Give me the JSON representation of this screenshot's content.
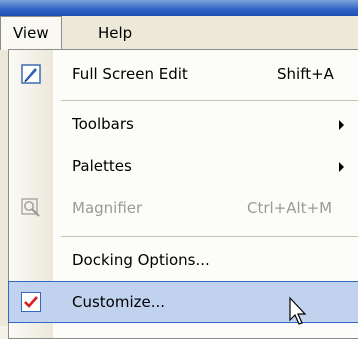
{
  "menubar": {
    "items": [
      {
        "label": "View",
        "active": true
      },
      {
        "label": "Help",
        "active": false
      }
    ]
  },
  "menu": {
    "items": [
      {
        "label": "Full Screen Edit",
        "shortcut": "Shift+A",
        "icon": "full-screen-edit-icon",
        "disabled": false,
        "submenu": false
      },
      {
        "label": "Toolbars",
        "shortcut": "",
        "icon": "",
        "disabled": false,
        "submenu": true
      },
      {
        "label": "Palettes",
        "shortcut": "",
        "icon": "",
        "disabled": false,
        "submenu": true
      },
      {
        "label": "Magnifier",
        "shortcut": "Ctrl+Alt+M",
        "icon": "magnifier-icon",
        "disabled": true,
        "submenu": false
      },
      {
        "label": "Docking Options...",
        "shortcut": "",
        "icon": "",
        "disabled": false,
        "submenu": false
      },
      {
        "label": "Customize...",
        "shortcut": "",
        "icon": "checkmark-icon",
        "disabled": false,
        "submenu": false,
        "selected": true
      }
    ]
  },
  "colors": {
    "highlight": "#c1d2ee",
    "highlight_border": "#316ac5",
    "check_red": "#d81e1e",
    "disabled_text": "#9b9a94"
  }
}
